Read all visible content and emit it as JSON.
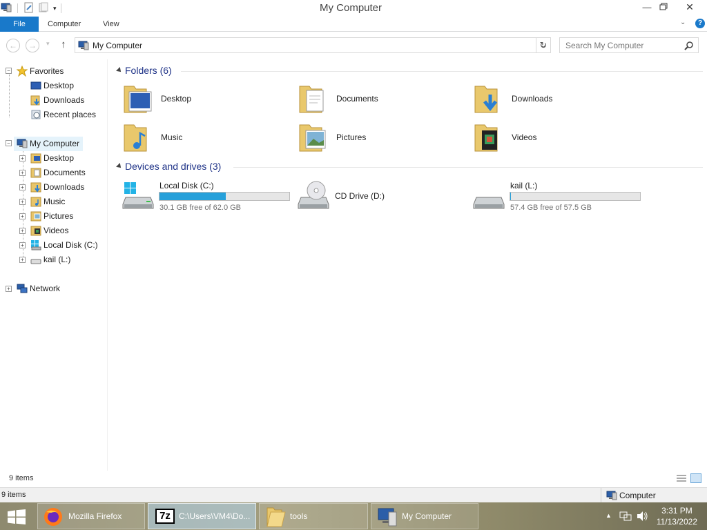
{
  "window": {
    "title": "My Computer"
  },
  "ribbon": {
    "tabs": [
      "File",
      "Computer",
      "View"
    ]
  },
  "address": {
    "path": "My Computer",
    "search_placeholder": "Search My Computer"
  },
  "navpane": {
    "favorites": {
      "label": "Favorites",
      "items": [
        "Desktop",
        "Downloads",
        "Recent places"
      ]
    },
    "computer": {
      "label": "My Computer",
      "items": [
        "Desktop",
        "Documents",
        "Downloads",
        "Music",
        "Pictures",
        "Videos",
        "Local Disk (C:)",
        "kail (L:)"
      ]
    },
    "network": {
      "label": "Network"
    }
  },
  "content": {
    "folders": {
      "header": "Folders (6)",
      "items": [
        "Desktop",
        "Documents",
        "Downloads",
        "Music",
        "Pictures",
        "Videos"
      ]
    },
    "drives": {
      "header": "Devices and drives (3)",
      "items": [
        {
          "name": "Local Disk (C:)",
          "free": "30.1 GB free of 62.0 GB",
          "used_fraction": 0.51
        },
        {
          "name": "CD Drive (D:)"
        },
        {
          "name": "kail (L:)",
          "free": "57.4 GB free of 57.5 GB",
          "used_fraction": 0.002
        }
      ]
    }
  },
  "status": {
    "items_count": "9 items",
    "bottom_count": "9 items",
    "location": "Computer"
  },
  "taskbar": {
    "items": [
      "Mozilla Firefox",
      "C:\\Users\\VM4\\Do...",
      "tools",
      "My Computer"
    ],
    "time": "3:31 PM",
    "date": "11/13/2022"
  },
  "colors": {
    "accent": "#1979ca",
    "drive_bar": "#26a0da",
    "group_header": "#1e3287"
  }
}
